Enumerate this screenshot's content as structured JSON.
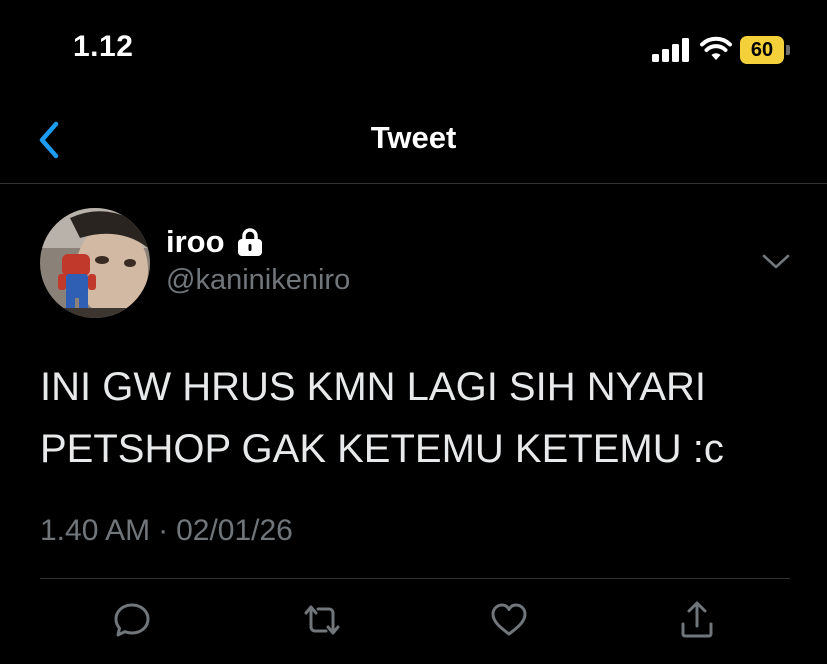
{
  "status_bar": {
    "time": "1.12",
    "battery_level": "60",
    "battery_color": "#f4d03a",
    "signal_icon": "cellular-signal-icon",
    "wifi_icon": "wifi-icon"
  },
  "header": {
    "title": "Tweet",
    "back_icon": "chevron-left-icon",
    "accent_color": "#1d9bf0"
  },
  "tweet": {
    "author": {
      "display_name": "iroo",
      "username": "@kaninikeniro",
      "protected_icon": "lock-icon"
    },
    "more_icon": "chevron-down-icon",
    "text_lines": [
      "INI GW HRUS KMN LAGI SIH NYARI",
      "PETSHOP GAK KETEMU KETEMU :c"
    ],
    "time": "1.40 AM",
    "separator": "·",
    "date": "02/01/26"
  },
  "actions": [
    {
      "icon": "reply-icon"
    },
    {
      "icon": "retweet-icon"
    },
    {
      "icon": "like-icon"
    },
    {
      "icon": "share-icon"
    }
  ]
}
